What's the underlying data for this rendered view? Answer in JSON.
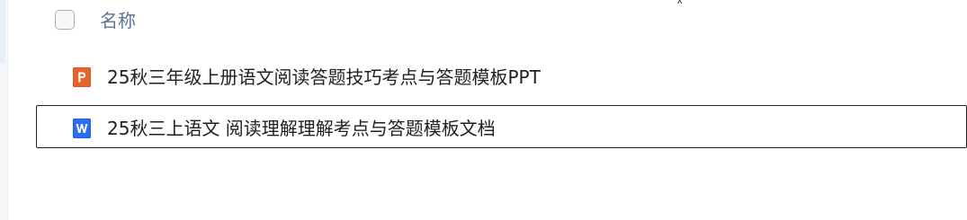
{
  "table": {
    "header": {
      "name_label": "名称"
    },
    "files": [
      {
        "name": "25秋三年级上册语文阅读答题技巧考点与答题模板PPT",
        "type": "ppt",
        "icon": "powerpoint-file-icon",
        "icon_letter": "P",
        "icon_color": "#e8632b",
        "selected": false
      },
      {
        "name": "25秋三上语文 阅读理解理解考点与答题模板文档",
        "type": "doc",
        "icon": "word-file-icon",
        "icon_letter": "W",
        "icon_color": "#2b6ef5",
        "selected": true
      }
    ]
  },
  "colors": {
    "header_text": "#5c7496",
    "selection_border": "#222222"
  }
}
